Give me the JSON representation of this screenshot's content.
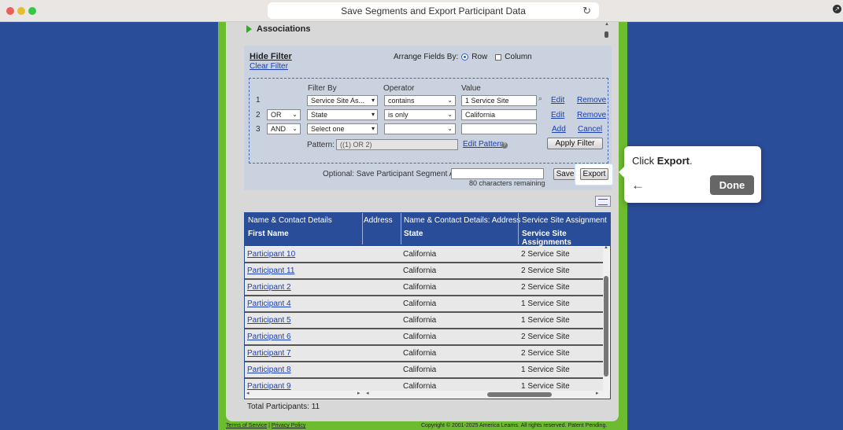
{
  "browser": {
    "title": "Save Segments and Export Participant Data",
    "reload_icon": "reload-icon"
  },
  "section": {
    "associations": "Associations"
  },
  "filter": {
    "hide": "Hide Filter",
    "clear": "Clear Filter",
    "arrange_label": "Arrange Fields By:",
    "row": "Row",
    "column": "Column",
    "headers": {
      "filter_by": "Filter By",
      "operator": "Operator",
      "value": "Value"
    },
    "rows": [
      {
        "num": "1",
        "logic": "",
        "field": "Service Site As...",
        "operator": "contains",
        "value": "1 Service Site",
        "action1": "Edit",
        "action2": "Remove"
      },
      {
        "num": "2",
        "logic": "OR",
        "field": "State",
        "operator": "is only",
        "value": "California",
        "action1": "Edit",
        "action2": "Remove"
      },
      {
        "num": "3",
        "logic": "AND",
        "field": "Select one",
        "operator": "",
        "value": "",
        "action1": "Add",
        "action2": "Cancel"
      }
    ],
    "pattern_label": "Pattern:",
    "pattern_value": "((1) OR 2)",
    "edit_pattern": "Edit Pattern",
    "apply": "Apply Filter"
  },
  "segment": {
    "label": "Optional: Save Participant Segment As:",
    "value": "",
    "remaining": "80 characters remaining",
    "save": "Save",
    "export": "Export"
  },
  "tooltip": {
    "prefix": "Click ",
    "bold": "Export",
    "suffix": ".",
    "done": "Done"
  },
  "table": {
    "group_headers": [
      "Name & Contact Details",
      "Address",
      "Name & Contact Details: Address",
      "Service Site Assignment"
    ],
    "col_headers": [
      "First Name",
      "",
      "State",
      "Service Site Assignments"
    ],
    "rows": [
      {
        "name": "Participant 10",
        "state": "California",
        "site": "2 Service Site"
      },
      {
        "name": "Participant 11",
        "state": "California",
        "site": "2 Service Site"
      },
      {
        "name": "Participant 2",
        "state": "California",
        "site": "2 Service Site"
      },
      {
        "name": "Participant 4",
        "state": "California",
        "site": "1 Service Site"
      },
      {
        "name": "Participant 5",
        "state": "California",
        "site": "1 Service Site"
      },
      {
        "name": "Participant 6",
        "state": "California",
        "site": "2 Service Site"
      },
      {
        "name": "Participant 7",
        "state": "California",
        "site": "2 Service Site"
      },
      {
        "name": "Participant 8",
        "state": "California",
        "site": "1 Service Site"
      },
      {
        "name": "Participant 9",
        "state": "California",
        "site": "1 Service Site"
      }
    ],
    "total": "Total Participants: 11"
  },
  "footer": {
    "terms": "Terms of Service",
    "sep": "|",
    "privacy": "Privacy Policy",
    "copyright": "Copyright © 2001-2025 America Learns. All rights reserved. Patent Pending."
  }
}
